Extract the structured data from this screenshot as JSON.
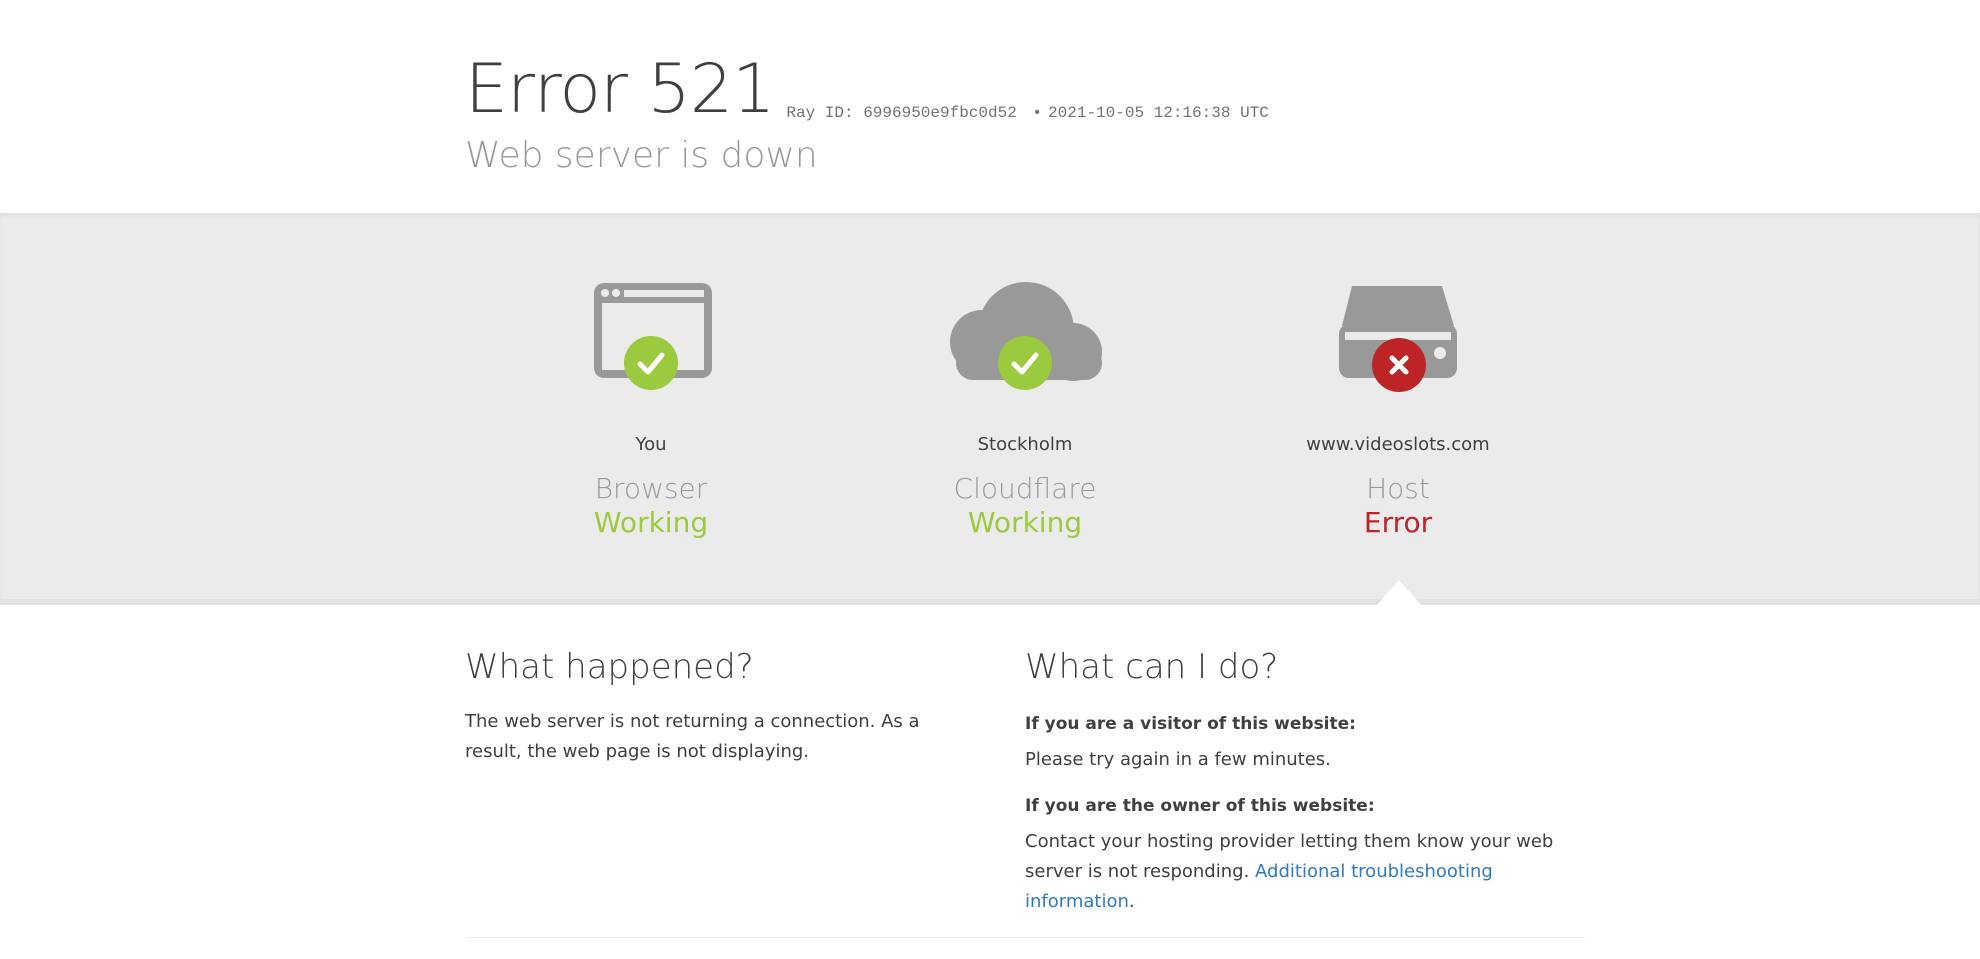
{
  "header": {
    "title": "Error 521",
    "ray_label": "Ray ID:",
    "ray_id": "6996950e9fbc0d52",
    "separator": "•",
    "timestamp": "2021-10-05 12:16:38 UTC",
    "subtitle": "Web server is down"
  },
  "status": {
    "nodes": [
      {
        "name": "You",
        "role": "Browser",
        "state": "Working",
        "icon": "browser-icon",
        "badge": "check-icon",
        "color": "#9bca3e"
      },
      {
        "name": "Stockholm",
        "role": "Cloudflare",
        "state": "Working",
        "icon": "cloud-icon",
        "badge": "check-icon",
        "color": "#9bca3e"
      },
      {
        "name": "www.videoslots.com",
        "role": "Host",
        "state": "Error",
        "icon": "server-icon",
        "badge": "x-icon",
        "color": "#bd2426"
      }
    ]
  },
  "what_happened": {
    "heading": "What happened?",
    "text": "The web server is not returning a connection. As a result, the web page is not displaying."
  },
  "what_can_i_do": {
    "heading": "What can I do?",
    "visitor_heading": "If you are a visitor of this website:",
    "visitor_text": "Please try again in a few minutes.",
    "owner_heading": "If you are the owner of this website:",
    "owner_text": "Contact your hosting provider letting them know your web server is not responding.",
    "link_text": "Additional troubleshooting information",
    "period": "."
  },
  "colors": {
    "ok": "#9bca3e",
    "error": "#bd2426",
    "icon_gray": "#999999",
    "link": "#2f7bbf"
  }
}
